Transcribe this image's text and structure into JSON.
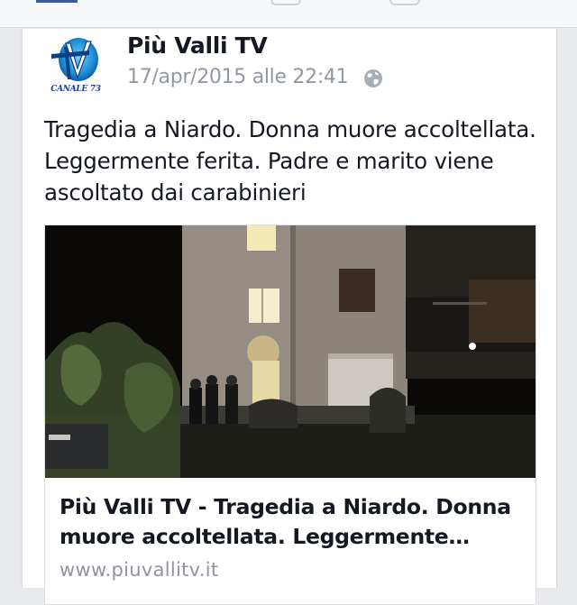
{
  "post": {
    "page_name": "Più Valli TV",
    "timestamp": "17/apr/2015 alle 22:41",
    "privacy_icon": "globe-icon",
    "avatar_caption": "CANALE 73",
    "text": "Tragedia a Niardo. Donna muore accoltellata. Leggermente ferita. Padre e marito viene ascoltato dai carabinieri"
  },
  "link_preview": {
    "title": "Più Valli TV - Tragedia a Niardo. Donna muore accoltellata. Leggermente ferita. Padre e marito viene ascoltato dai carabinieri",
    "domain": "www.piuvallitv.it"
  },
  "colors": {
    "background": "#e9eaed",
    "card": "#ffffff",
    "text": "#141823",
    "meta_text": "#9197a3",
    "brand_blue": "#1b3f9a"
  }
}
